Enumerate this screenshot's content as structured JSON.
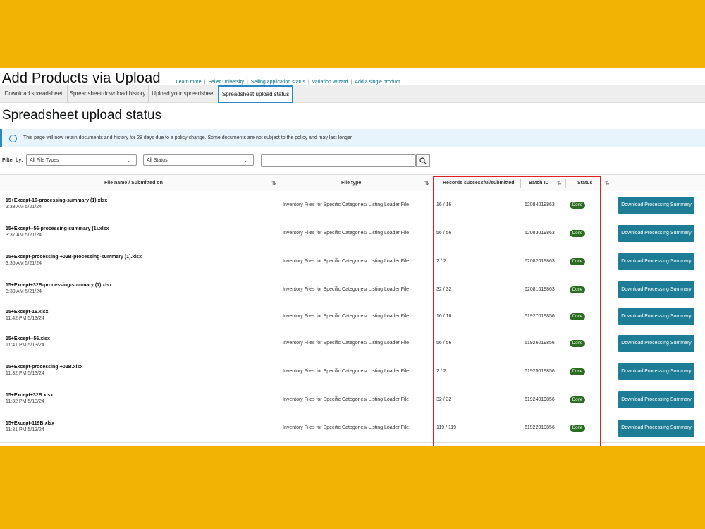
{
  "page": {
    "title": "Add Products via Upload",
    "quick_links": [
      "Learn more",
      "Seller University",
      "Selling application status",
      "Variation Wizard",
      "Add a single product"
    ]
  },
  "tabs": [
    "Download spreadsheet",
    "Spreadsheet download history",
    "Upload your spreadsheet",
    "Spreadsheet upload status"
  ],
  "active_tab": "Spreadsheet upload status",
  "section_title": "Spreadsheet upload status",
  "info_banner": "This page will now retain documents and history for 28 days due to a policy change. Some documents are not subject to the policy and may last longer.",
  "filters": {
    "label": "Filter by:",
    "file_type": "All File Types",
    "status": "All Status",
    "search_value": ""
  },
  "columns": {
    "file": "File name / Submitted on",
    "type": "File type",
    "records": "Records successful/submitted",
    "batch": "Batch ID",
    "status": "Status"
  },
  "rows": [
    {
      "name": "15+Except-16-processing-summary (1).xlsx",
      "date": "3:38 AM 5/21/24",
      "type": "Inventory Files for Specific Categories/ Listing Loader File",
      "records": "16 / 16",
      "batch": "62084019863",
      "status": "Done",
      "action": "Download Processing Summary"
    },
    {
      "name": "15+Except--56-processing-summary (1).xlsx",
      "date": "3:37 AM 5/21/24",
      "type": "Inventory Files for Specific Categories/ Listing Loader File",
      "records": "56 / 56",
      "batch": "62083019863",
      "status": "Done",
      "action": "Download Processing Summary"
    },
    {
      "name": "15+Except-processing-+02B-processing-summary (1).xlsx",
      "date": "3:35 AM 5/21/24",
      "type": "Inventory Files for Specific Categories/ Listing Loader File",
      "records": "2 / 2",
      "batch": "62082019863",
      "status": "Done",
      "action": "Download Processing Summary"
    },
    {
      "name": "15+Except+32B-processing-summary (1).xlsx",
      "date": "3:30 AM 5/21/24",
      "type": "Inventory Files for Specific Categories/ Listing Loader File",
      "records": "32 / 32",
      "batch": "62081019863",
      "status": "Done",
      "action": "Download Processing Summary"
    },
    {
      "name": "15+Except-16.xlsx",
      "date": "11:42 PM 5/13/24",
      "type": "Inventory Files for Specific Categories/ Listing Loader File",
      "records": "16 / 16",
      "batch": "61927019856",
      "status": "Done",
      "action": "Download Processing Summary"
    },
    {
      "name": "15+Except--56.xlsx",
      "date": "11:41 PM 5/13/24",
      "type": "Inventory Files for Specific Categories/ Listing Loader File",
      "records": "56 / 56",
      "batch": "61926019856",
      "status": "Done",
      "action": "Download Processing Summary"
    },
    {
      "name": "15+Except-processing-+02B.xlsx",
      "date": "11:32 PM 5/13/24",
      "type": "Inventory Files for Specific Categories/ Listing Loader File",
      "records": "2 / 2",
      "batch": "61925019856",
      "status": "Done",
      "action": "Download Processing Summary"
    },
    {
      "name": "15+Except+32B.xlsx",
      "date": "11:32 PM 5/13/24",
      "type": "Inventory Files for Specific Categories/ Listing Loader File",
      "records": "32 / 32",
      "batch": "61924019856",
      "status": "Done",
      "action": "Download Processing Summary"
    },
    {
      "name": "15+Except-119B.xlsx",
      "date": "11:31 PM 5/13/24",
      "type": "Inventory Files for Specific Categories/ Listing Loader File",
      "records": "119 / 119",
      "batch": "61922019856",
      "status": "Done",
      "action": "Download Processing Summary"
    }
  ],
  "colors": {
    "background": "#f2b304",
    "link": "#007185",
    "button": "#1e7d96",
    "done_badge": "#2b6e22",
    "highlight": "#e02020"
  }
}
